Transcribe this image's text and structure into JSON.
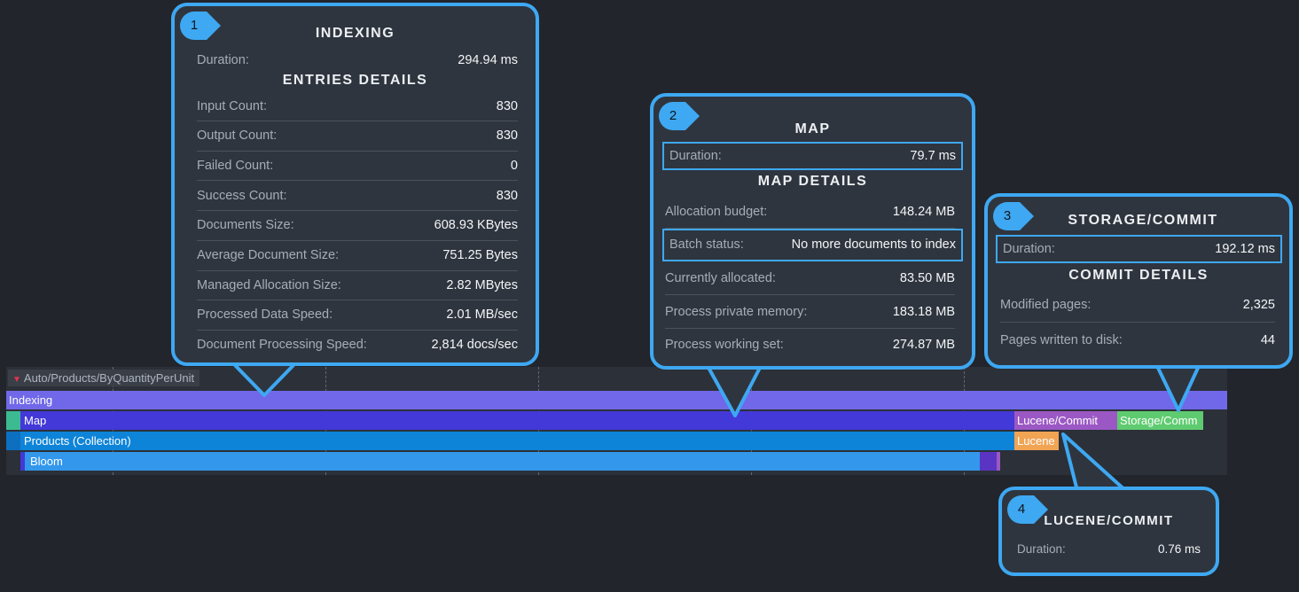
{
  "timeline": {
    "tab_label": "Auto/Products/ByQuantityPerUnit",
    "bars": {
      "indexing": "Indexing",
      "map": "Map",
      "lucene_commit": "Lucene/Commit",
      "storage_commit": "Storage/Comm",
      "products_collection": "Products (Collection)",
      "lucene": "Lucene",
      "bloom": "Bloom"
    }
  },
  "callouts": [
    {
      "number": "1",
      "title": "INDEXING",
      "duration_label": "Duration:",
      "duration_value": "294.94 ms",
      "details_title": "ENTRIES DETAILS",
      "rows": [
        {
          "label": "Input Count:",
          "value": "830"
        },
        {
          "label": "Output Count:",
          "value": "830"
        },
        {
          "label": "Failed Count:",
          "value": "0"
        },
        {
          "label": "Success Count:",
          "value": "830"
        },
        {
          "label": "Documents Size:",
          "value": "608.93 KBytes"
        },
        {
          "label": "Average Document Size:",
          "value": "751.25 Bytes"
        },
        {
          "label": "Managed Allocation Size:",
          "value": "2.82 MBytes"
        },
        {
          "label": "Processed Data Speed:",
          "value": "2.01 MB/sec"
        },
        {
          "label": "Document Processing Speed:",
          "value": "2,814 docs/sec"
        }
      ]
    },
    {
      "number": "2",
      "title": "MAP",
      "duration_label": "Duration:",
      "duration_value": "79.7 ms",
      "details_title": "MAP DETAILS",
      "rows": [
        {
          "label": "Allocation budget:",
          "value": "148.24 MB"
        },
        {
          "label": "Batch status:",
          "value": "No more documents to index"
        },
        {
          "label": "Currently allocated:",
          "value": "83.50 MB"
        },
        {
          "label": "Process private memory:",
          "value": "183.18 MB"
        },
        {
          "label": "Process working set:",
          "value": "274.87 MB"
        }
      ]
    },
    {
      "number": "3",
      "title": "STORAGE/COMMIT",
      "duration_label": "Duration:",
      "duration_value": "192.12 ms",
      "details_title": "COMMIT DETAILS",
      "rows": [
        {
          "label": "Modified pages:",
          "value": "2,325"
        },
        {
          "label": "Pages written to disk:",
          "value": "44"
        }
      ]
    },
    {
      "number": "4",
      "title": "LUCENE/COMMIT",
      "duration_label": "Duration:",
      "duration_value": "0.76 ms"
    }
  ],
  "colors": {
    "accent": "#3ea8f2",
    "indexing": "#7068e8",
    "map": "#4338d8",
    "products": "#0e84d8",
    "bloom": "#3398ec",
    "lucene_commit": "#9b58c4",
    "storage_commit": "#5fcb70",
    "lucene": "#f1a454"
  }
}
